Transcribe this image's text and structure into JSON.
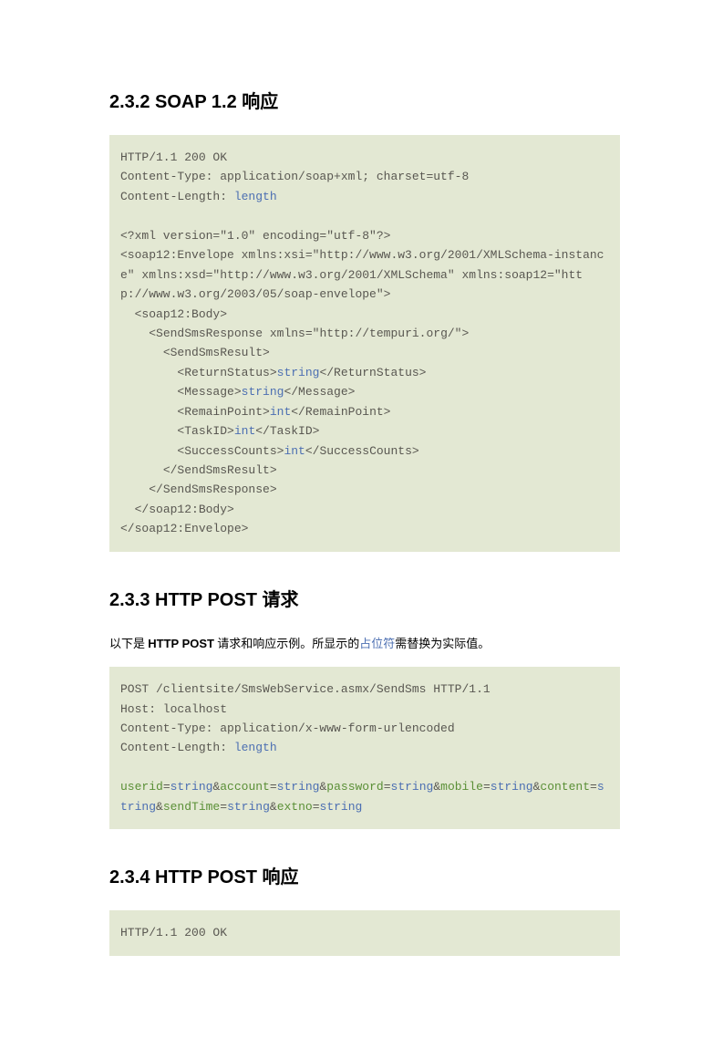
{
  "section1": {
    "heading": "2.3.2  SOAP 1.2 响应",
    "code_parts": [
      {
        "t": "HTTP/1.1 200 OK\nContent-Type: application/soap+xml; charset=utf-8\nContent-Length: "
      },
      {
        "t": "length",
        "c": "kw-blue"
      },
      {
        "t": "\n\n<?xml version=\"1.0\" encoding=\"utf-8\"?>\n<soap12:Envelope xmlns:xsi=\"http://www.w3.org/2001/XMLSchema-instance\" xmlns:xsd=\"http://www.w3.org/2001/XMLSchema\" xmlns:soap12=\"http://www.w3.org/2003/05/soap-envelope\">\n  <soap12:Body>\n    <SendSmsResponse xmlns=\"http://tempuri.org/\">\n      <SendSmsResult>\n        <ReturnStatus>"
      },
      {
        "t": "string",
        "c": "kw-blue"
      },
      {
        "t": "</ReturnStatus>\n        <Message>"
      },
      {
        "t": "string",
        "c": "kw-blue"
      },
      {
        "t": "</Message>\n        <RemainPoint>"
      },
      {
        "t": "int",
        "c": "kw-blue"
      },
      {
        "t": "</RemainPoint>\n        <TaskID>"
      },
      {
        "t": "int",
        "c": "kw-blue"
      },
      {
        "t": "</TaskID>\n        <SuccessCounts>"
      },
      {
        "t": "int",
        "c": "kw-blue"
      },
      {
        "t": "</SuccessCounts>\n      </SendSmsResult>\n    </SendSmsResponse>\n  </soap12:Body>\n</soap12:Envelope>"
      }
    ]
  },
  "section2": {
    "heading": "2.3.3  HTTP POST 请求",
    "desc_parts": [
      {
        "t": "以下是 "
      },
      {
        "t": "HTTP POST",
        "c": "bold"
      },
      {
        "t": " 请求和响应示例。所显示的"
      },
      {
        "t": "占位符",
        "c": "ph"
      },
      {
        "t": "需替换为实际值。"
      }
    ],
    "code_parts": [
      {
        "t": "POST /clientsite/SmsWebService.asmx/SendSms HTTP/1.1\nHost: localhost\nContent-Type: application/x-www-form-urlencoded\nContent-Length: "
      },
      {
        "t": "length",
        "c": "kw-blue"
      },
      {
        "t": "\n\n"
      },
      {
        "t": "userid",
        "c": "kw-green"
      },
      {
        "t": "="
      },
      {
        "t": "string",
        "c": "kw-blue"
      },
      {
        "t": "&"
      },
      {
        "t": "account",
        "c": "kw-green"
      },
      {
        "t": "="
      },
      {
        "t": "string",
        "c": "kw-blue"
      },
      {
        "t": "&"
      },
      {
        "t": "password",
        "c": "kw-green"
      },
      {
        "t": "="
      },
      {
        "t": "string",
        "c": "kw-blue"
      },
      {
        "t": "&"
      },
      {
        "t": "mobile",
        "c": "kw-green"
      },
      {
        "t": "="
      },
      {
        "t": "string",
        "c": "kw-blue"
      },
      {
        "t": "&"
      },
      {
        "t": "content",
        "c": "kw-green"
      },
      {
        "t": "="
      },
      {
        "t": "string",
        "c": "kw-blue"
      },
      {
        "t": "&"
      },
      {
        "t": "sendTime",
        "c": "kw-green"
      },
      {
        "t": "="
      },
      {
        "t": "string",
        "c": "kw-blue"
      },
      {
        "t": "&"
      },
      {
        "t": "extno",
        "c": "kw-green"
      },
      {
        "t": "="
      },
      {
        "t": "string",
        "c": "kw-blue"
      }
    ]
  },
  "section3": {
    "heading": "2.3.4  HTTP POST 响应",
    "code_parts": [
      {
        "t": "HTTP/1.1 200 OK"
      }
    ]
  }
}
